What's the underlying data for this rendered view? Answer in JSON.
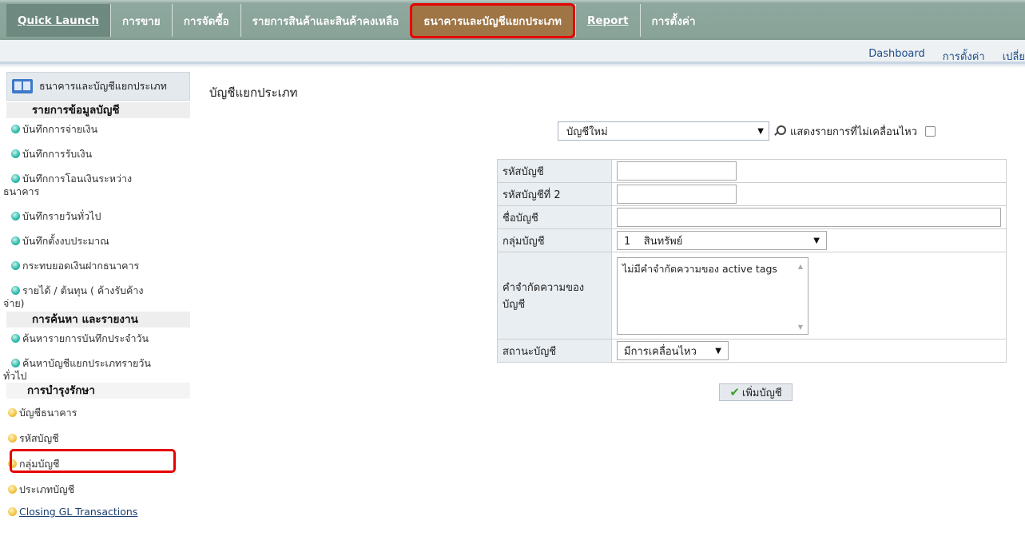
{
  "nav": {
    "items": [
      {
        "label": "Quick Launch",
        "underline_first": true
      },
      {
        "label": "การขาย"
      },
      {
        "label": "การจัดซื้อ"
      },
      {
        "label": "รายการสินค้าและสินค้าคงเหลือ"
      },
      {
        "label": "ธนาคารและบัญชีแยกประเภท"
      },
      {
        "label": "Report",
        "underline_first": true
      },
      {
        "label": "การตั้งค่า"
      }
    ],
    "active_index": 4
  },
  "sublinks": [
    "Dashboard",
    "การตั้งค่า",
    "เปลี่ย"
  ],
  "sidebar": {
    "header": "ธนาคารและบัญชีแยกประเภท",
    "section1": "รายการข้อมูลบัญชี",
    "items1": [
      "บันทึกการจ่ายเงิน",
      "บันทึกการรับเงิน",
      "บันทึกการโอนเงินระหว่าง",
      "ธนาคาร",
      "บันทึกรายวันทั่วไป",
      "บันทึกตั้งงบประมาณ",
      "กระทบยอดเงินฝากธนาคาร",
      "รายได้ / ต้นทุน ( ค้างรับค้าง",
      "จ่าย)"
    ],
    "section2": "การค้นหา และรายงาน",
    "items2": [
      "ค้นหารายการบันทึกประจำวัน",
      "ค้นหาบัญชีแยกประเภทรายวัน",
      "ทั่วไป"
    ],
    "section3": "การบำรุงรักษา",
    "items3": [
      "บัญชีธนาคาร",
      "รหัสบัญชี",
      "กลุ่มบัญชี",
      "ประเภทบัญชี",
      "Closing GL Transactions"
    ]
  },
  "main": {
    "title": "บัญชีแยกประเภท",
    "account_select": "บัญชีใหม่",
    "show_inactive_label": "แสดงรายการที่ไม่เคลื่อนไหว",
    "form": {
      "code_label": "รหัสบัญชี",
      "code2_label": "รหัสบัญชีที่ 2",
      "name_label": "ชื่อบัญชี",
      "group_label": "กลุ่มบัญชี",
      "group_value": "1    สินทรัพย์",
      "tags_label": "คำจำกัดความของบัญชี",
      "tags_value": "ไม่มีคำจำกัดความของ active tags",
      "status_label": "สถานะบัญชี",
      "status_value": "มีการเคลื่อนไหว"
    },
    "add_button": "เพิ่มบัญชี"
  }
}
